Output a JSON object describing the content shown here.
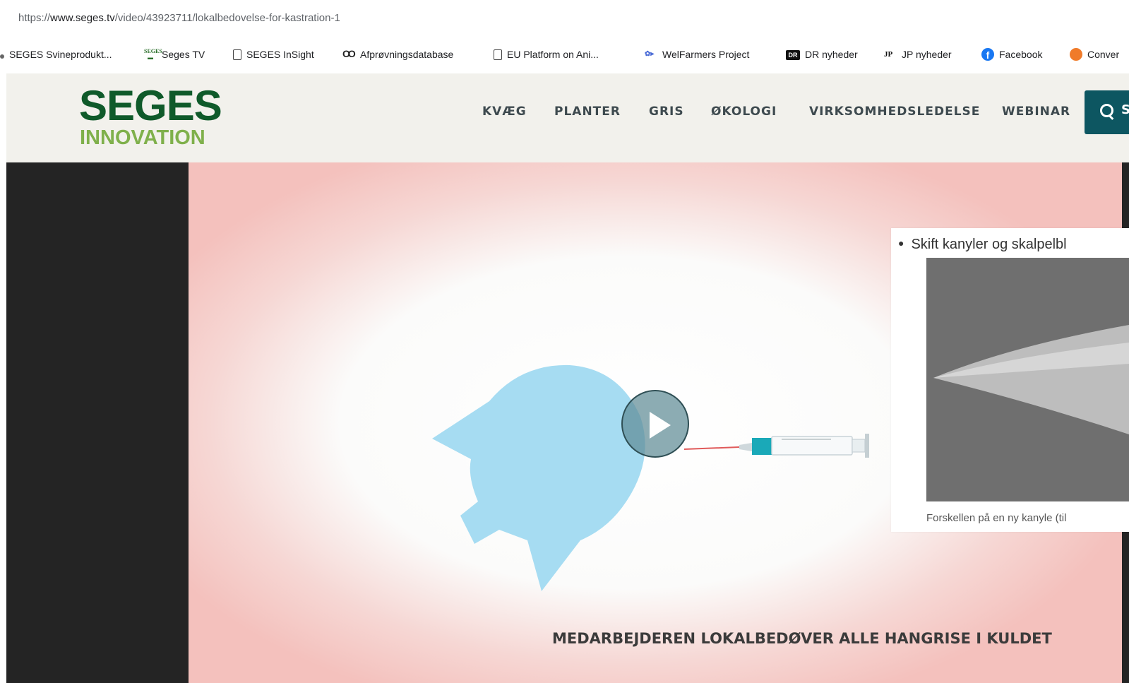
{
  "browser": {
    "url_scheme": "https://",
    "url_host": "www.seges.tv",
    "url_path": "/video/43923711/lokalbedovelse-for-kastration-1"
  },
  "bookmarks": [
    {
      "label": "SEGES Svineprodukt...",
      "icon": "dot-icon"
    },
    {
      "label": "Seges TV",
      "icon": "seges-icon"
    },
    {
      "label": "SEGES InSight",
      "icon": "document-icon"
    },
    {
      "label": "Afprøvningsdatabase",
      "icon": "infinity-icon"
    },
    {
      "label": "EU Platform on Ani...",
      "icon": "document-icon"
    },
    {
      "label": "WelFarmers Project",
      "icon": "welfarmers-icon"
    },
    {
      "label": "DR nyheder",
      "icon": "dr-icon"
    },
    {
      "label": "JP nyheder",
      "icon": "jp-icon"
    },
    {
      "label": "Facebook",
      "icon": "facebook-icon"
    },
    {
      "label": "Conver",
      "icon": "converter-icon"
    }
  ],
  "header": {
    "logo_top": "SEGES",
    "logo_bottom": "INNOVATION",
    "nav": [
      "KVÆG",
      "PLANTER",
      "GRIS",
      "ØKOLOGI",
      "VIRKSOMHEDSLEDELSE",
      "WEBINAR"
    ],
    "search_label": "S",
    "colors": {
      "logo_dark": "#0f5a2a",
      "logo_light": "#7fb04b",
      "search_bg": "#0d5661",
      "header_bg": "#f2f1ec"
    }
  },
  "video": {
    "caption": "MEDARBEJDEREN LOKALBEDØVER ALLE HANGRISE I KULDET",
    "play_icon": "play-icon"
  },
  "panel": {
    "bullet_text": "Skift kanyler og skalpelbl",
    "photo_caption": "Forskellen på en ny kanyle (til"
  }
}
